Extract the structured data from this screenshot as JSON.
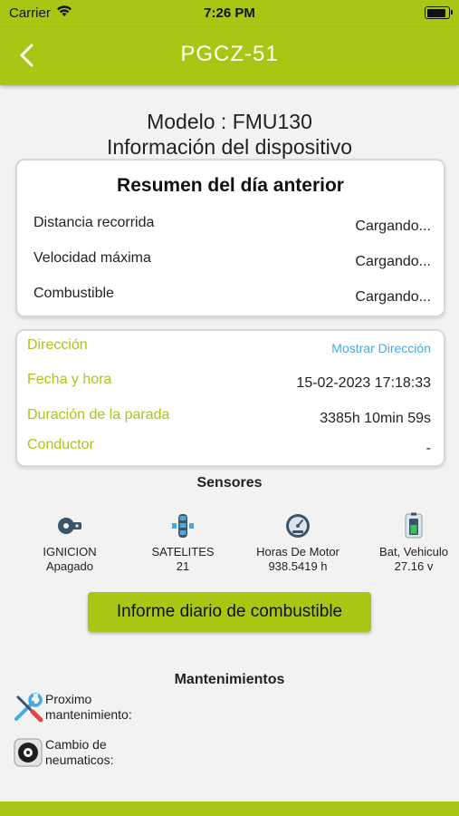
{
  "status_bar": {
    "carrier": "Carrier",
    "time": "7:26 PM"
  },
  "nav": {
    "title": "PGCZ-51",
    "back_icon": "chevron-left-icon"
  },
  "device": {
    "model": "Modelo : FMU130",
    "subtitle": "Información del dispositivo"
  },
  "summary": {
    "heading": "Resumen del día anterior",
    "rows": [
      {
        "label": "Distancia recorrida",
        "value": "Cargando..."
      },
      {
        "label": "Velocidad máxima",
        "value": "Cargando..."
      },
      {
        "label": "Combustible",
        "value": "Cargando..."
      }
    ]
  },
  "details": {
    "direccion_label": "Dirección",
    "direccion_link": "Mostrar Dirección",
    "fecha_label": "Fecha y hora",
    "fecha_value": "15-02-2023 17:18:33",
    "duracion_label": "Duración de la parada",
    "duracion_value": "3385h 10min 59s",
    "conductor_label": "Conductor",
    "conductor_value": "-"
  },
  "sensors": {
    "title": "Sensores",
    "items": [
      {
        "name": "IGNICION",
        "value": "Apagado",
        "icon": "ignition-key-icon"
      },
      {
        "name": "SATELITES",
        "value": "21",
        "icon": "satellite-icon"
      },
      {
        "name": "Horas De Motor",
        "value": "938.5419 h",
        "icon": "gauge-icon"
      },
      {
        "name": "Bat, Vehiculo",
        "value": "27.16 v",
        "icon": "battery-icon"
      }
    ]
  },
  "fuel_button": {
    "label": "Informe diario de combustible"
  },
  "maintenance": {
    "title": "Mantenimientos",
    "items": [
      {
        "line1": "Proximo",
        "line2": "mantenimiento:",
        "icon": "wrench-screwdriver-icon"
      },
      {
        "line1": "Cambio de",
        "line2": "neumaticos:",
        "icon": "tire-icon"
      }
    ]
  },
  "colors": {
    "accent": "#a9c615",
    "link": "#4aa8e0",
    "background": "#f2f2f2"
  }
}
